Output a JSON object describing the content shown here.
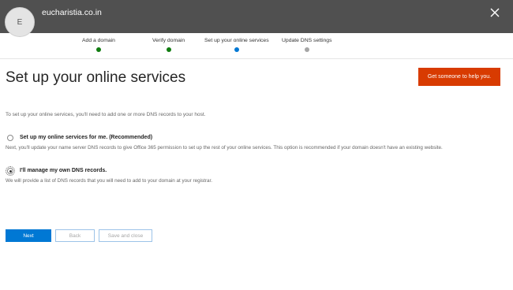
{
  "header": {
    "avatar_initial": "E",
    "domain": "eucharistia.co.in",
    "close_icon": "close-icon"
  },
  "steps": [
    {
      "label": "Add a domain",
      "status": "complete",
      "color": "#107c10"
    },
    {
      "label": "Verify domain",
      "status": "complete",
      "color": "#107c10"
    },
    {
      "label": "Set up your online services",
      "status": "current",
      "color": "#0078d4"
    },
    {
      "label": "Update DNS settings",
      "status": "pending",
      "color": "#a6a6a6"
    }
  ],
  "main": {
    "title": "Set up your online services",
    "help_button": "Get someone to help you.",
    "intro": "To set up your online services, you'll need to add one or more DNS records to your host.",
    "options": [
      {
        "label": "Set up my online services for me. (Recommended)",
        "description": "Next, you'll update your name server DNS records to give Office 365 permission to set up the rest of your online services. This option is recommended if your domain doesn't have an existing website.",
        "selected": false
      },
      {
        "label": "I'll manage my own DNS records.",
        "description": "We will provide a list of DNS records that you will need to add to your domain at your registrar.",
        "selected": true
      }
    ]
  },
  "footer": {
    "next": "Next",
    "back": "Back",
    "save_close": "Save and close"
  },
  "colors": {
    "topbar": "#505050",
    "accent": "#0078d4",
    "help_button": "#d83b01"
  }
}
